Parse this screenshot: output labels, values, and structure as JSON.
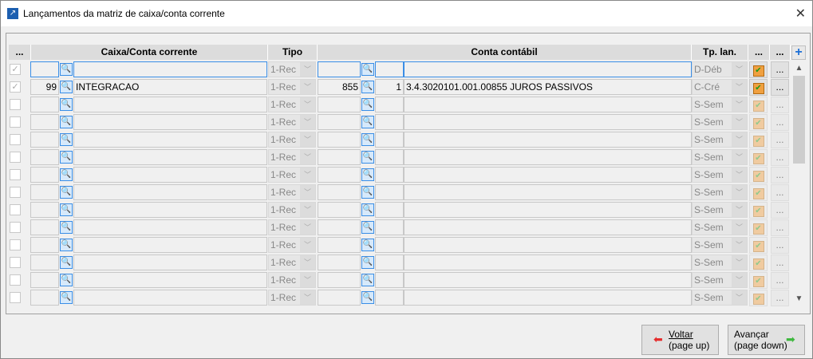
{
  "window": {
    "title": "Lançamentos da matriz de caixa/conta corrente",
    "close": "✕"
  },
  "headers": {
    "sel": "...",
    "caixa": "Caixa/Conta corrente",
    "tipo": "Tipo",
    "conta": "Conta contábil",
    "tplan": "Tp. lan.",
    "b1": "...",
    "b2": "..."
  },
  "rows": [
    {
      "checked": true,
      "code": "",
      "name": "",
      "tipo": "1-Rec",
      "conta": "",
      "sub": "",
      "desc": "",
      "tplan": "D-Déb",
      "active": true,
      "enabled": true
    },
    {
      "checked": true,
      "code": "99",
      "name": "INTEGRACAO",
      "tipo": "1-Rec",
      "conta": "855",
      "sub": "1",
      "desc": "3.4.3020101.001.00855 JUROS PASSIVOS",
      "tplan": "C-Cré",
      "enabled": true
    },
    {
      "checked": false,
      "code": "",
      "name": "",
      "tipo": "1-Rec",
      "conta": "",
      "sub": "",
      "desc": "",
      "tplan": "S-Sem"
    },
    {
      "checked": false,
      "code": "",
      "name": "",
      "tipo": "1-Rec",
      "conta": "",
      "sub": "",
      "desc": "",
      "tplan": "S-Sem"
    },
    {
      "checked": false,
      "code": "",
      "name": "",
      "tipo": "1-Rec",
      "conta": "",
      "sub": "",
      "desc": "",
      "tplan": "S-Sem"
    },
    {
      "checked": false,
      "code": "",
      "name": "",
      "tipo": "1-Rec",
      "conta": "",
      "sub": "",
      "desc": "",
      "tplan": "S-Sem"
    },
    {
      "checked": false,
      "code": "",
      "name": "",
      "tipo": "1-Rec",
      "conta": "",
      "sub": "",
      "desc": "",
      "tplan": "S-Sem"
    },
    {
      "checked": false,
      "code": "",
      "name": "",
      "tipo": "1-Rec",
      "conta": "",
      "sub": "",
      "desc": "",
      "tplan": "S-Sem"
    },
    {
      "checked": false,
      "code": "",
      "name": "",
      "tipo": "1-Rec",
      "conta": "",
      "sub": "",
      "desc": "",
      "tplan": "S-Sem"
    },
    {
      "checked": false,
      "code": "",
      "name": "",
      "tipo": "1-Rec",
      "conta": "",
      "sub": "",
      "desc": "",
      "tplan": "S-Sem"
    },
    {
      "checked": false,
      "code": "",
      "name": "",
      "tipo": "1-Rec",
      "conta": "",
      "sub": "",
      "desc": "",
      "tplan": "S-Sem"
    },
    {
      "checked": false,
      "code": "",
      "name": "",
      "tipo": "1-Rec",
      "conta": "",
      "sub": "",
      "desc": "",
      "tplan": "S-Sem"
    },
    {
      "checked": false,
      "code": "",
      "name": "",
      "tipo": "1-Rec",
      "conta": "",
      "sub": "",
      "desc": "",
      "tplan": "S-Sem"
    },
    {
      "checked": false,
      "code": "",
      "name": "",
      "tipo": "1-Rec",
      "conta": "",
      "sub": "",
      "desc": "",
      "tplan": "S-Sem"
    }
  ],
  "ellipsis": "...",
  "buttons": {
    "back_line1": "Voltar",
    "back_line2": "(page up)",
    "next_line1": "Avançar",
    "next_line2": "(page down)"
  }
}
